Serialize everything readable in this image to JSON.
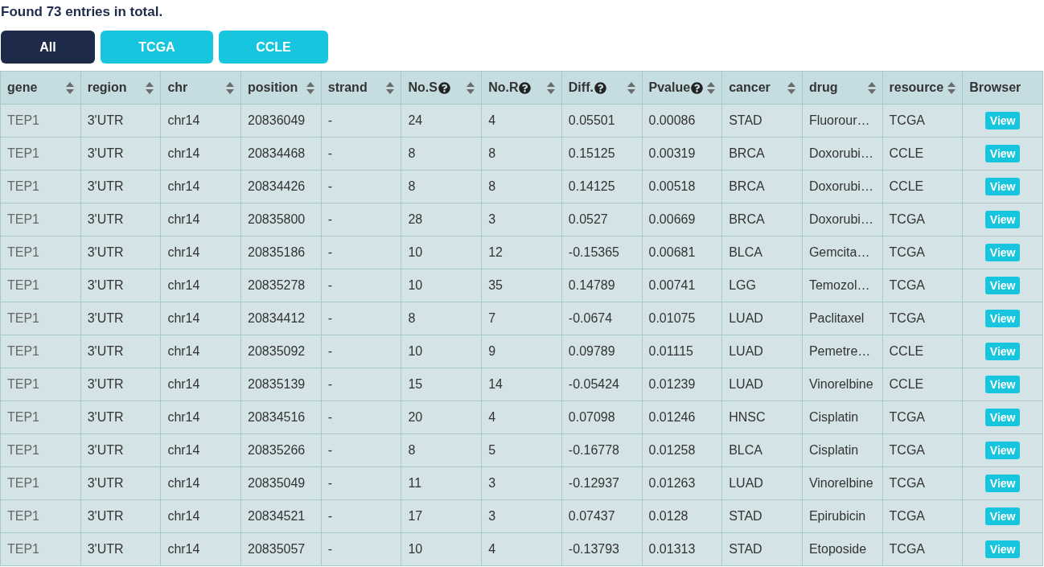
{
  "summary": "Found 73 entries in total.",
  "filters": [
    {
      "label": "All",
      "selected": true
    },
    {
      "label": "TCGA",
      "selected": false
    },
    {
      "label": "CCLE",
      "selected": false
    }
  ],
  "table": {
    "columns": [
      {
        "label": "gene",
        "help": false,
        "sortable": true
      },
      {
        "label": "region",
        "help": false,
        "sortable": true
      },
      {
        "label": "chr",
        "help": false,
        "sortable": true
      },
      {
        "label": "position",
        "help": false,
        "sortable": true
      },
      {
        "label": "strand",
        "help": false,
        "sortable": true
      },
      {
        "label": "No.S",
        "help": true,
        "sortable": true
      },
      {
        "label": "No.R",
        "help": true,
        "sortable": true
      },
      {
        "label": "Diff.",
        "help": true,
        "sortable": true
      },
      {
        "label": "Pvalue",
        "help": true,
        "sortable": true
      },
      {
        "label": "cancer",
        "help": false,
        "sortable": true
      },
      {
        "label": "drug",
        "help": false,
        "sortable": true
      },
      {
        "label": "resource",
        "help": false,
        "sortable": true
      },
      {
        "label": "Browser",
        "help": false,
        "sortable": false
      }
    ],
    "rows": [
      [
        "TEP1",
        "3'UTR",
        "chr14",
        "20836049",
        "-",
        "24",
        "4",
        "0.05501",
        "0.00086",
        "STAD",
        "Fluorour…",
        "TCGA",
        "View"
      ],
      [
        "TEP1",
        "3'UTR",
        "chr14",
        "20834468",
        "-",
        "8",
        "8",
        "0.15125",
        "0.00319",
        "BRCA",
        "Doxorubi…",
        "CCLE",
        "View"
      ],
      [
        "TEP1",
        "3'UTR",
        "chr14",
        "20834426",
        "-",
        "8",
        "8",
        "0.14125",
        "0.00518",
        "BRCA",
        "Doxorubi…",
        "CCLE",
        "View"
      ],
      [
        "TEP1",
        "3'UTR",
        "chr14",
        "20835800",
        "-",
        "28",
        "3",
        "0.0527",
        "0.00669",
        "BRCA",
        "Doxorubi…",
        "TCGA",
        "View"
      ],
      [
        "TEP1",
        "3'UTR",
        "chr14",
        "20835186",
        "-",
        "10",
        "12",
        "-0.15365",
        "0.00681",
        "BLCA",
        "Gemcita…",
        "TCGA",
        "View"
      ],
      [
        "TEP1",
        "3'UTR",
        "chr14",
        "20835278",
        "-",
        "10",
        "35",
        "0.14789",
        "0.00741",
        "LGG",
        "Temozol…",
        "TCGA",
        "View"
      ],
      [
        "TEP1",
        "3'UTR",
        "chr14",
        "20834412",
        "-",
        "8",
        "7",
        "-0.0674",
        "0.01075",
        "LUAD",
        "Paclitaxel",
        "TCGA",
        "View"
      ],
      [
        "TEP1",
        "3'UTR",
        "chr14",
        "20835092",
        "-",
        "10",
        "9",
        "0.09789",
        "0.01115",
        "LUAD",
        "Pemetre…",
        "CCLE",
        "View"
      ],
      [
        "TEP1",
        "3'UTR",
        "chr14",
        "20835139",
        "-",
        "15",
        "14",
        "-0.05424",
        "0.01239",
        "LUAD",
        "Vinorelbine",
        "CCLE",
        "View"
      ],
      [
        "TEP1",
        "3'UTR",
        "chr14",
        "20834516",
        "-",
        "20",
        "4",
        "0.07098",
        "0.01246",
        "HNSC",
        "Cisplatin",
        "TCGA",
        "View"
      ],
      [
        "TEP1",
        "3'UTR",
        "chr14",
        "20835266",
        "-",
        "8",
        "5",
        "-0.16778",
        "0.01258",
        "BLCA",
        "Cisplatin",
        "TCGA",
        "View"
      ],
      [
        "TEP1",
        "3'UTR",
        "chr14",
        "20835049",
        "-",
        "11",
        "3",
        "-0.12937",
        "0.01263",
        "LUAD",
        "Vinorelbine",
        "TCGA",
        "View"
      ],
      [
        "TEP1",
        "3'UTR",
        "chr14",
        "20834521",
        "-",
        "17",
        "3",
        "0.07437",
        "0.0128",
        "STAD",
        "Epirubicin",
        "TCGA",
        "View"
      ],
      [
        "TEP1",
        "3'UTR",
        "chr14",
        "20835057",
        "-",
        "10",
        "4",
        "-0.13793",
        "0.01313",
        "STAD",
        "Etoposide",
        "TCGA",
        "View"
      ]
    ]
  }
}
